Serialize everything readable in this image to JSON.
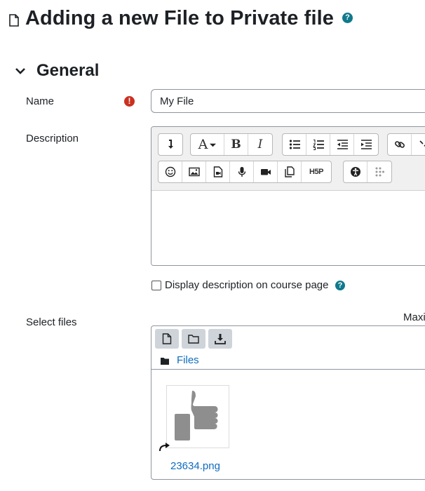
{
  "heading": {
    "title": "Adding a new File to Private file",
    "help_glyph": "?"
  },
  "section": {
    "title": "General"
  },
  "name_field": {
    "label": "Name",
    "value": "My File",
    "required_glyph": "!"
  },
  "description": {
    "label": "Description",
    "toolbar": {
      "row1": [
        "collapse-icon",
        "font-color-icon",
        "bold-icon",
        "italic-icon",
        "unordered-list-icon",
        "ordered-list-icon",
        "outdent-icon",
        "indent-icon",
        "link-icon",
        "unlink-icon"
      ],
      "row2": [
        "emoji-icon",
        "image-icon",
        "media-icon",
        "record-audio-icon",
        "record-video-icon",
        "manage-files-icon",
        "h5p-icon",
        "accessibility-checker-icon",
        "screenreader-helper-icon"
      ],
      "bold_glyph": "B",
      "italic_glyph": "I",
      "font_glyph": "A",
      "h5p_glyph": "H5P"
    },
    "display_on_course_label": "Display description on course page",
    "display_on_course_checked": false,
    "help_glyph": "?"
  },
  "select_files": {
    "label": "Select files",
    "max_text": "Maxi",
    "path_label": "Files",
    "file": {
      "name": "23634.png"
    }
  },
  "colors": {
    "link": "#0f6cbf",
    "required": "#ca3120",
    "help": "#0f7a8c",
    "button_bg": "#ced4da"
  }
}
